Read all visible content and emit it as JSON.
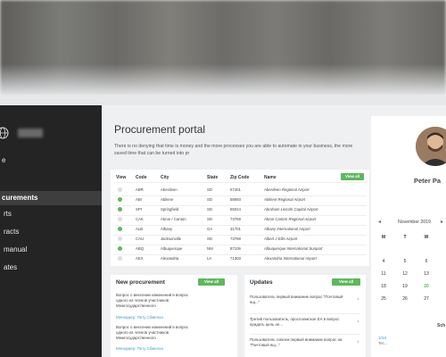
{
  "sidebar": {
    "items": [
      {
        "label": "e"
      },
      {
        "label": "curements"
      },
      {
        "label": "rts"
      },
      {
        "label": "racts"
      },
      {
        "label": "manual"
      },
      {
        "label": "ates"
      }
    ],
    "active_index": 1
  },
  "portal": {
    "title": "Procurement portal",
    "description": "There is no denying that time is money and the more processes you are able to automate in your business, the more saved time that can be turned into pr"
  },
  "table": {
    "headers": [
      "View",
      "Code",
      "City",
      "State",
      "Zip Code",
      "Name"
    ],
    "view_button": "View all",
    "rows": [
      {
        "on": false,
        "code": "ABR",
        "city": "Aberdeen",
        "state": "SD",
        "zip": "57401",
        "name": "Aberdeen Regional Airport"
      },
      {
        "on": true,
        "code": "ABI",
        "city": "Abilene",
        "state": "SD",
        "zip": "58693",
        "name": "Abilene Regional Airport"
      },
      {
        "on": true,
        "code": "SPI",
        "city": "Springfield",
        "state": "SD",
        "zip": "59314",
        "name": "Abraham Lincoln Capital Airport"
      },
      {
        "on": false,
        "code": "CAK",
        "city": "Akron / Canton",
        "state": "SD",
        "zip": "73769",
        "name": "Akron Canton Regional Airport"
      },
      {
        "on": true,
        "code": "ALB",
        "city": "Albany",
        "state": "GA",
        "zip": "31701",
        "name": "Albany International Airport"
      },
      {
        "on": false,
        "code": "CAU",
        "city": "Jacksonville",
        "state": "SD",
        "zip": "73769",
        "name": "Albert J Ellis Airport"
      },
      {
        "on": true,
        "code": "ABQ",
        "city": "Albuquerque",
        "state": "NM",
        "zip": "87106",
        "name": "Albuquerque International Sunport"
      },
      {
        "on": false,
        "code": "AEX",
        "city": "Alexandria",
        "state": "LA",
        "zip": "71303",
        "name": "Alexandria International Airport"
      }
    ]
  },
  "new_procurement": {
    "title": "New procurement",
    "button": "View all",
    "items": [
      {
        "text": "Вопрос о внесении изменений в вопрос одного из членов участников Межгосударственного",
        "author": "Менеджер: Пету Сбмичон"
      },
      {
        "text": "Вопрос о внесении изменений в вопрос одного из членов участников Межгосударственного",
        "author": "Менеджер: Пету Сбмичон"
      }
    ]
  },
  "updates": {
    "title": "Updates",
    "button": "View all",
    "items": [
      {
        "text": "Пользователь первый внимание вопрос \"Почтовый ящ...\""
      },
      {
        "text": "Третий пользователь, прослоемское ЕА в вопрос придать цель не..."
      },
      {
        "text": "Пользователь совсем первый внимание вопрос на \"Почтовый ящ...\""
      }
    ]
  },
  "profile": {
    "name": "Peter Pa"
  },
  "calendar": {
    "month": "November 2019",
    "headers": [
      "M",
      "T",
      "W"
    ],
    "rows": [
      [
        "",
        "",
        ""
      ],
      [
        "4",
        "5",
        "6"
      ],
      [
        "11",
        "12",
        "13"
      ],
      [
        "18",
        "19",
        "20"
      ],
      [
        "25",
        "26",
        "27"
      ]
    ],
    "highlight": "20"
  },
  "right_bottom": {
    "title": "Sch",
    "link": "1010",
    "text": "Тес..."
  },
  "colors": {
    "accent": "#5cb85c",
    "link": "#3a9fd6",
    "sidebar": "#242424"
  }
}
